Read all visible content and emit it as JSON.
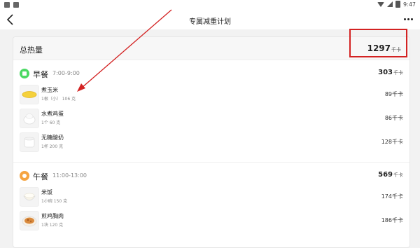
{
  "status_bar": {
    "left_icons": [
      "notification-icon",
      "image-icon"
    ],
    "time": "9:47",
    "right_icons": [
      "wifi-icon",
      "signal-icon",
      "battery-icon"
    ]
  },
  "nav": {
    "title": "专属减重计划",
    "back_icon": "chevron-left-icon",
    "more_icon": "more-horizontal-icon"
  },
  "summary": {
    "total_label": "总热量",
    "total_value": "1297",
    "unit": "千卡"
  },
  "meals": [
    {
      "name": "早餐",
      "time": "7:00-9:00",
      "total": "303",
      "unit": "千卡",
      "icon": "breakfast-icon",
      "icon_color": "#4cd964",
      "foods": [
        {
          "name": "煮玉米",
          "amount": "1根（小） 106 克",
          "calories": "89千卡"
        },
        {
          "name": "水煮鸡蛋",
          "amount": "1个 60 克",
          "calories": "86千卡"
        },
        {
          "name": "无糖酸奶",
          "amount": "1杯 200 克",
          "calories": "128千卡"
        }
      ]
    },
    {
      "name": "午餐",
      "time": "11:00-13:00",
      "total": "569",
      "unit": "千卡",
      "icon": "lunch-icon",
      "icon_color": "#f5a441",
      "foods": [
        {
          "name": "米饭",
          "amount": "1小碗 150 克",
          "calories": "174千卡"
        },
        {
          "name": "煎鸡胸肉",
          "amount": "1块 120 克",
          "calories": "186千卡"
        }
      ]
    }
  ],
  "annotation_color": "#d32222"
}
